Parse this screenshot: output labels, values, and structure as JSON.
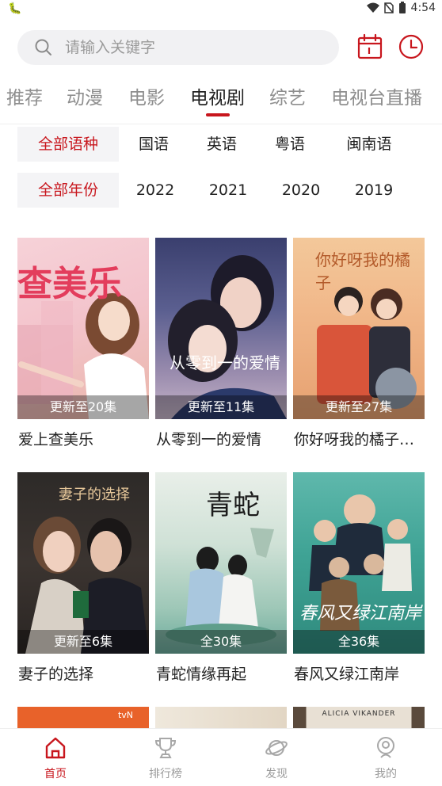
{
  "status_bar": {
    "left_icon": "debug-bug-icon",
    "time": "4:54"
  },
  "search": {
    "placeholder": "请输入关键字"
  },
  "header_icons": [
    "calendar-icon",
    "history-clock-icon"
  ],
  "tabs": [
    {
      "label": "推荐"
    },
    {
      "label": "动漫"
    },
    {
      "label": "电影"
    },
    {
      "label": "电视剧",
      "active": true
    },
    {
      "label": "综艺"
    },
    {
      "label": "电视台直播"
    }
  ],
  "language_filter": [
    "全部语种",
    "国语",
    "英语",
    "粤语",
    "闽南语"
  ],
  "year_filter": [
    "全部年份",
    "2022",
    "2021",
    "2020",
    "2019"
  ],
  "shows": [
    {
      "title": "爱上查美乐",
      "badge": "更新至20集",
      "poster_text": "查美乐"
    },
    {
      "title": "从零到一的爱情",
      "badge": "更新至11集",
      "poster_text": "从零到一的爱情"
    },
    {
      "title": "你好呀我的橘子…",
      "badge": "更新至27集",
      "poster_text": "你好呀我的橘子"
    },
    {
      "title": "妻子的选择",
      "badge": "更新至6集",
      "poster_text": "妻子的选择"
    },
    {
      "title": "青蛇情缘再起",
      "badge": "全30集",
      "poster_text": "青蛇"
    },
    {
      "title": "春风又绿江南岸",
      "badge": "全36集",
      "poster_text": "春风又绿江南岸"
    },
    {
      "title": "",
      "badge": "",
      "poster_text": "tvN"
    },
    {
      "title": "",
      "badge": "",
      "poster_text": ""
    },
    {
      "title": "",
      "badge": "",
      "poster_text": "ALICIA VIKANDER"
    }
  ],
  "bottom_nav": [
    {
      "label": "首页",
      "icon": "home-icon",
      "active": true
    },
    {
      "label": "排行榜",
      "icon": "trophy-icon"
    },
    {
      "label": "发现",
      "icon": "planet-icon"
    },
    {
      "label": "我的",
      "icon": "profile-icon"
    }
  ],
  "colors": {
    "accent": "#c8161d",
    "chip_bg": "#f4f4f6",
    "search_bg": "#f1f1f3"
  }
}
